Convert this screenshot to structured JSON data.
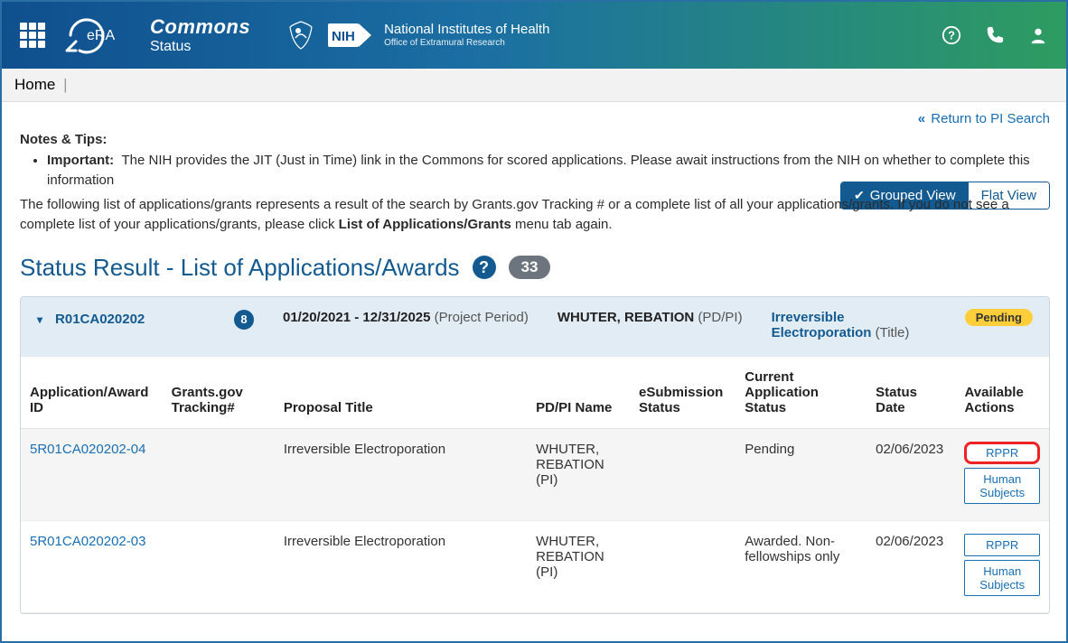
{
  "header": {
    "brand_name": "Commons",
    "brand_sub": "Status",
    "nih_title": "National Institutes of Health",
    "nih_sub": "Office of Extramural Research",
    "nih_label": "NIH"
  },
  "breadcrumb": {
    "home": "Home"
  },
  "return_link": "Return to PI Search",
  "notes": {
    "heading": "Notes & Tips:",
    "bullet_strong": "Important:",
    "bullet_text": "The NIH provides the JIT (Just in Time) link in the Commons for scored applications. Please await instructions from the NIH on whether to complete this information",
    "para_1": "The following list of applications/grants represents a result of the search by Grants.gov Tracking # or a complete list of all your applications/grants. If you do not see a complete list of your applications/grants, please click ",
    "para_bold": "List of Applications/Grants",
    "para_2": " menu tab again."
  },
  "section": {
    "title": "Status Result - List of Applications/Awards",
    "count": "33",
    "grouped_label": "Grouped View",
    "flat_label": "Flat View"
  },
  "group": {
    "id": "R01CA020202",
    "badge": "8",
    "period": "01/20/2021 - 12/31/2025",
    "period_label": "(Project Period)",
    "pi_name": "WHUTER, REBATION",
    "pi_role": "(PD/PI)",
    "title": "Irreversible Electroporation",
    "title_label": "(Title)",
    "status": "Pending"
  },
  "table": {
    "headers": {
      "id": "Application/Award ID",
      "tracking": "Grants.gov Tracking#",
      "title": "Proposal Title",
      "pi": "PD/PI Name",
      "esub": "eSubmission Status",
      "appstatus": "Current Application Status",
      "date": "Status Date",
      "actions": "Available Actions"
    },
    "rows": [
      {
        "id": "5R01CA020202-04",
        "tracking": "",
        "title": "Irreversible Electroporation",
        "pi": "WHUTER, REBATION (PI)",
        "esub": "",
        "appstatus": "Pending",
        "date": "02/06/2023",
        "actions": [
          "RPPR",
          "Human Subjects"
        ],
        "highlight_first": true
      },
      {
        "id": "5R01CA020202-03",
        "tracking": "",
        "title": "Irreversible Electroporation",
        "pi": "WHUTER, REBATION (PI)",
        "esub": "",
        "appstatus": "Awarded. Non-fellowships only",
        "date": "02/06/2023",
        "actions": [
          "RPPR",
          "Human Subjects"
        ],
        "highlight_first": false
      }
    ]
  }
}
